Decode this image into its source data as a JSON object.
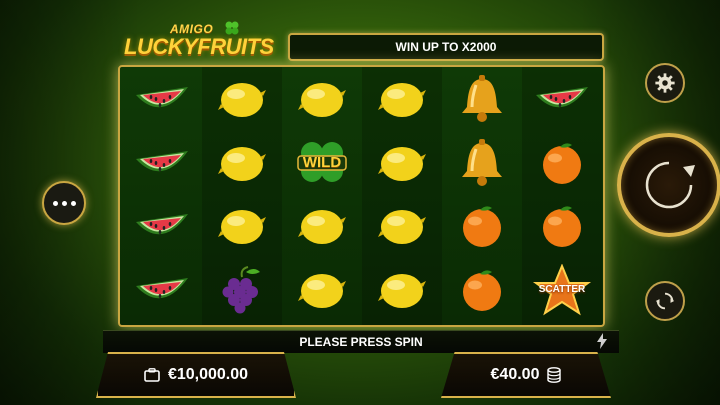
{
  "logo": {
    "line1": "AMIGO",
    "line2": "LUCKYFRUITS"
  },
  "banner": {
    "text": "WIN UP TO X2000"
  },
  "reels": [
    [
      "watermelon",
      "watermelon",
      "watermelon",
      "watermelon"
    ],
    [
      "lemon",
      "lemon",
      "lemon",
      "grapes"
    ],
    [
      "lemon",
      "wild",
      "lemon",
      "lemon"
    ],
    [
      "lemon",
      "lemon",
      "lemon",
      "lemon"
    ],
    [
      "bell",
      "bell",
      "orange",
      "orange"
    ],
    [
      "watermelon",
      "orange",
      "orange",
      "scatter"
    ]
  ],
  "symbol_text": {
    "wild": "WILD",
    "scatter": "SCATTER"
  },
  "message": {
    "text": "PLEASE PRESS SPIN"
  },
  "balance": {
    "amount": "€10,000.00",
    "icon": "wallet-icon"
  },
  "bet": {
    "amount": "€40.00",
    "icon": "coins-icon"
  },
  "controls": {
    "menu_icon": "more-dots-icon",
    "settings_icon": "gear-icon",
    "spin_icon": "spin-arrow-icon",
    "autoplay_icon": "autoplay-icon",
    "turbo_icon": "lightning-icon"
  },
  "colors": {
    "gold": "#c9a641",
    "background": "#2f5a0a"
  }
}
